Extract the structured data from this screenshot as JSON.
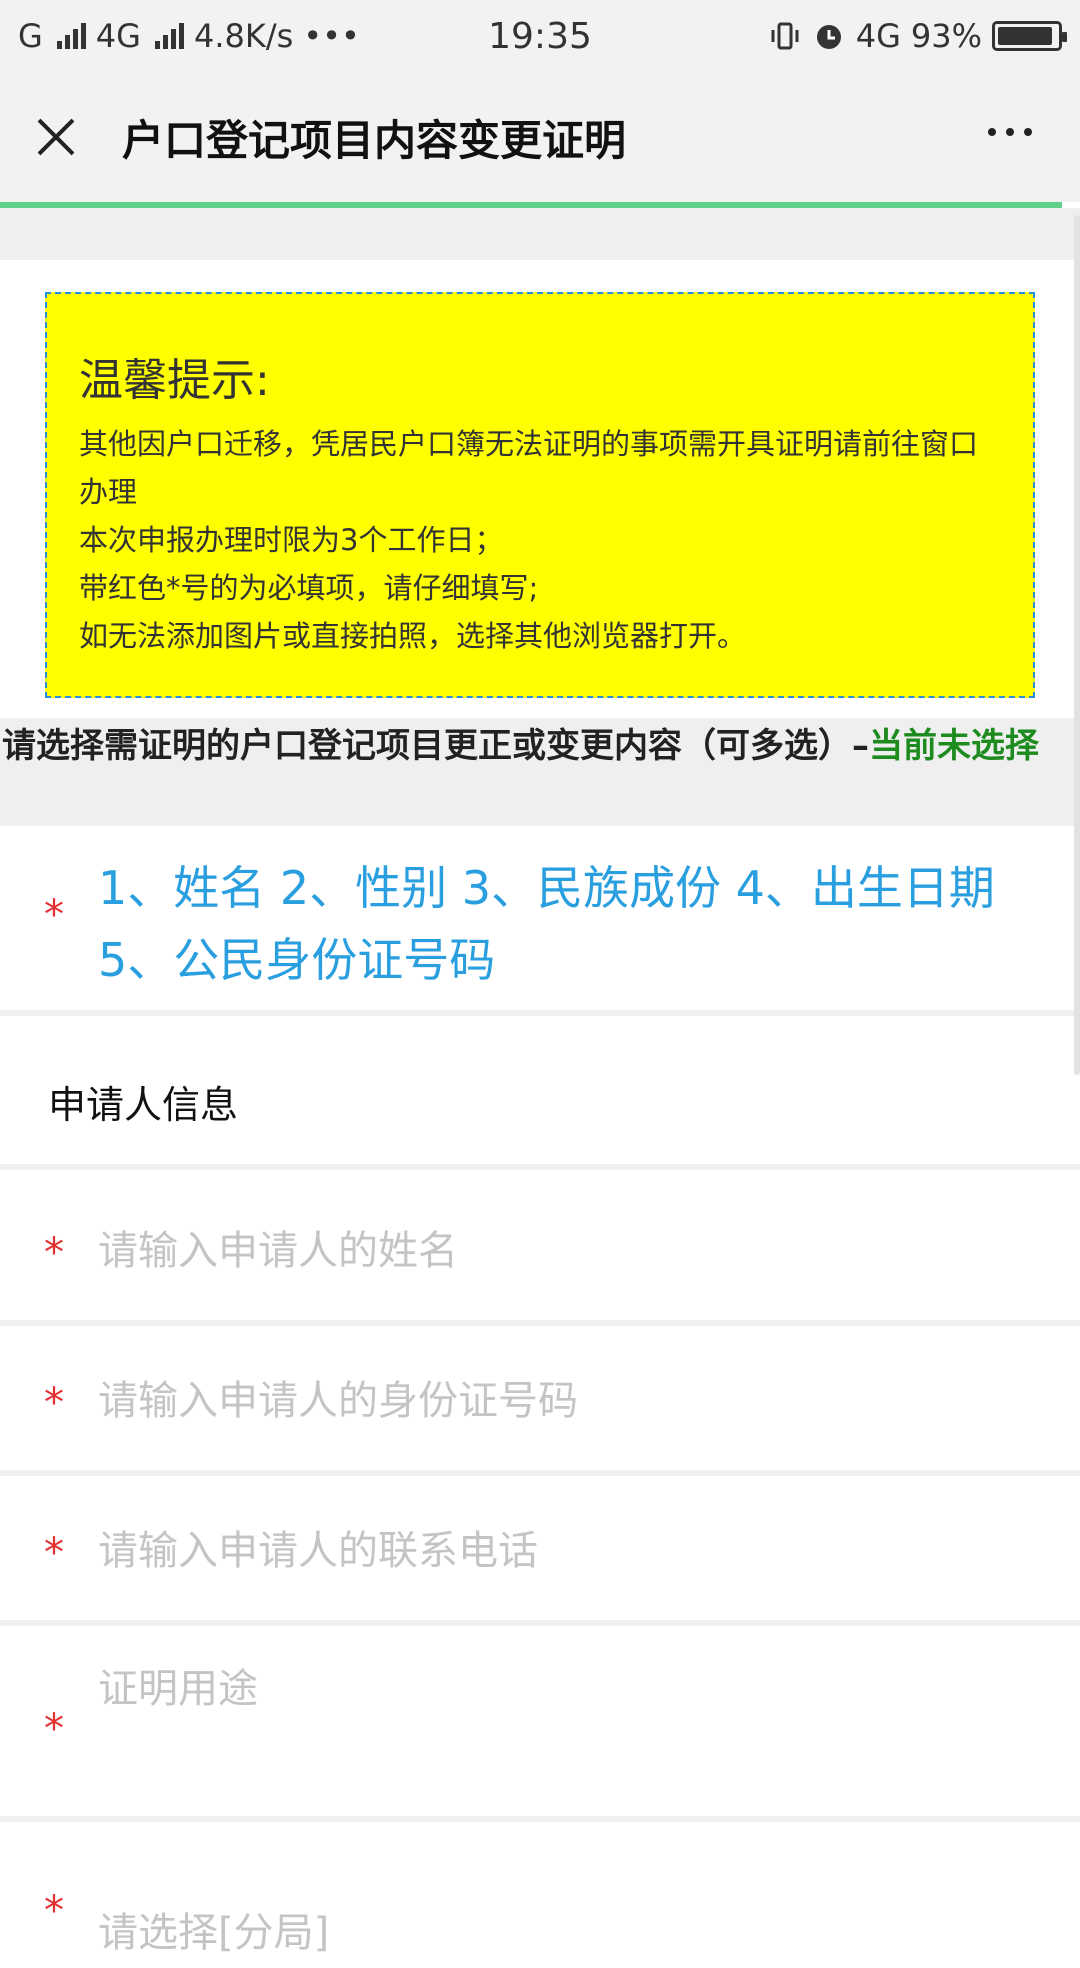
{
  "status_bar": {
    "carrier1": "G",
    "carrier2": "4G",
    "speed": "4.8K/s",
    "dots": "•••",
    "time": "19:35",
    "network": "4G",
    "battery": "93%",
    "battery_level": 0.93
  },
  "header": {
    "title": "户口登记项目内容变更证明",
    "close_icon": "close-icon",
    "more_icon": "more-icon"
  },
  "notice": {
    "title": "温馨提示:",
    "lines": [
      "其他因户口迁移，凭居民户口簿无法证明的事项需开具证明请前往窗口办理",
      "本次申报办理时限为3个工作日；",
      "带红色*号的为必填项，请仔细填写;",
      "如无法添加图片或直接拍照，选择其他浏览器打开。"
    ]
  },
  "select_section": {
    "prompt": "请选择需证明的户口登记项目更正或变更内容（可多选）–",
    "status": "当前未选择",
    "required_mark": "*",
    "options_text": "1、姓名 2、性别 3、民族成份 4、出生日期 5、公民身份证号码"
  },
  "applicant": {
    "section_title": "申请人信息",
    "fields": [
      {
        "required": "*",
        "placeholder": "请输入申请人的姓名",
        "value": ""
      },
      {
        "required": "*",
        "placeholder": "请输入申请人的身份证号码",
        "value": ""
      },
      {
        "required": "*",
        "placeholder": "请输入申请人的联系电话",
        "value": ""
      },
      {
        "required": "*",
        "placeholder": "证明用途",
        "value": ""
      },
      {
        "required": "*",
        "placeholder": "请选择[分局]",
        "value": ""
      }
    ]
  },
  "colors": {
    "accent_progress": "#5fcf8a",
    "notice_bg": "#ffff00",
    "notice_border": "#2a8fd6",
    "required": "#e23030",
    "options_text": "#2a9fe0",
    "status_green": "#1e8b1e"
  }
}
